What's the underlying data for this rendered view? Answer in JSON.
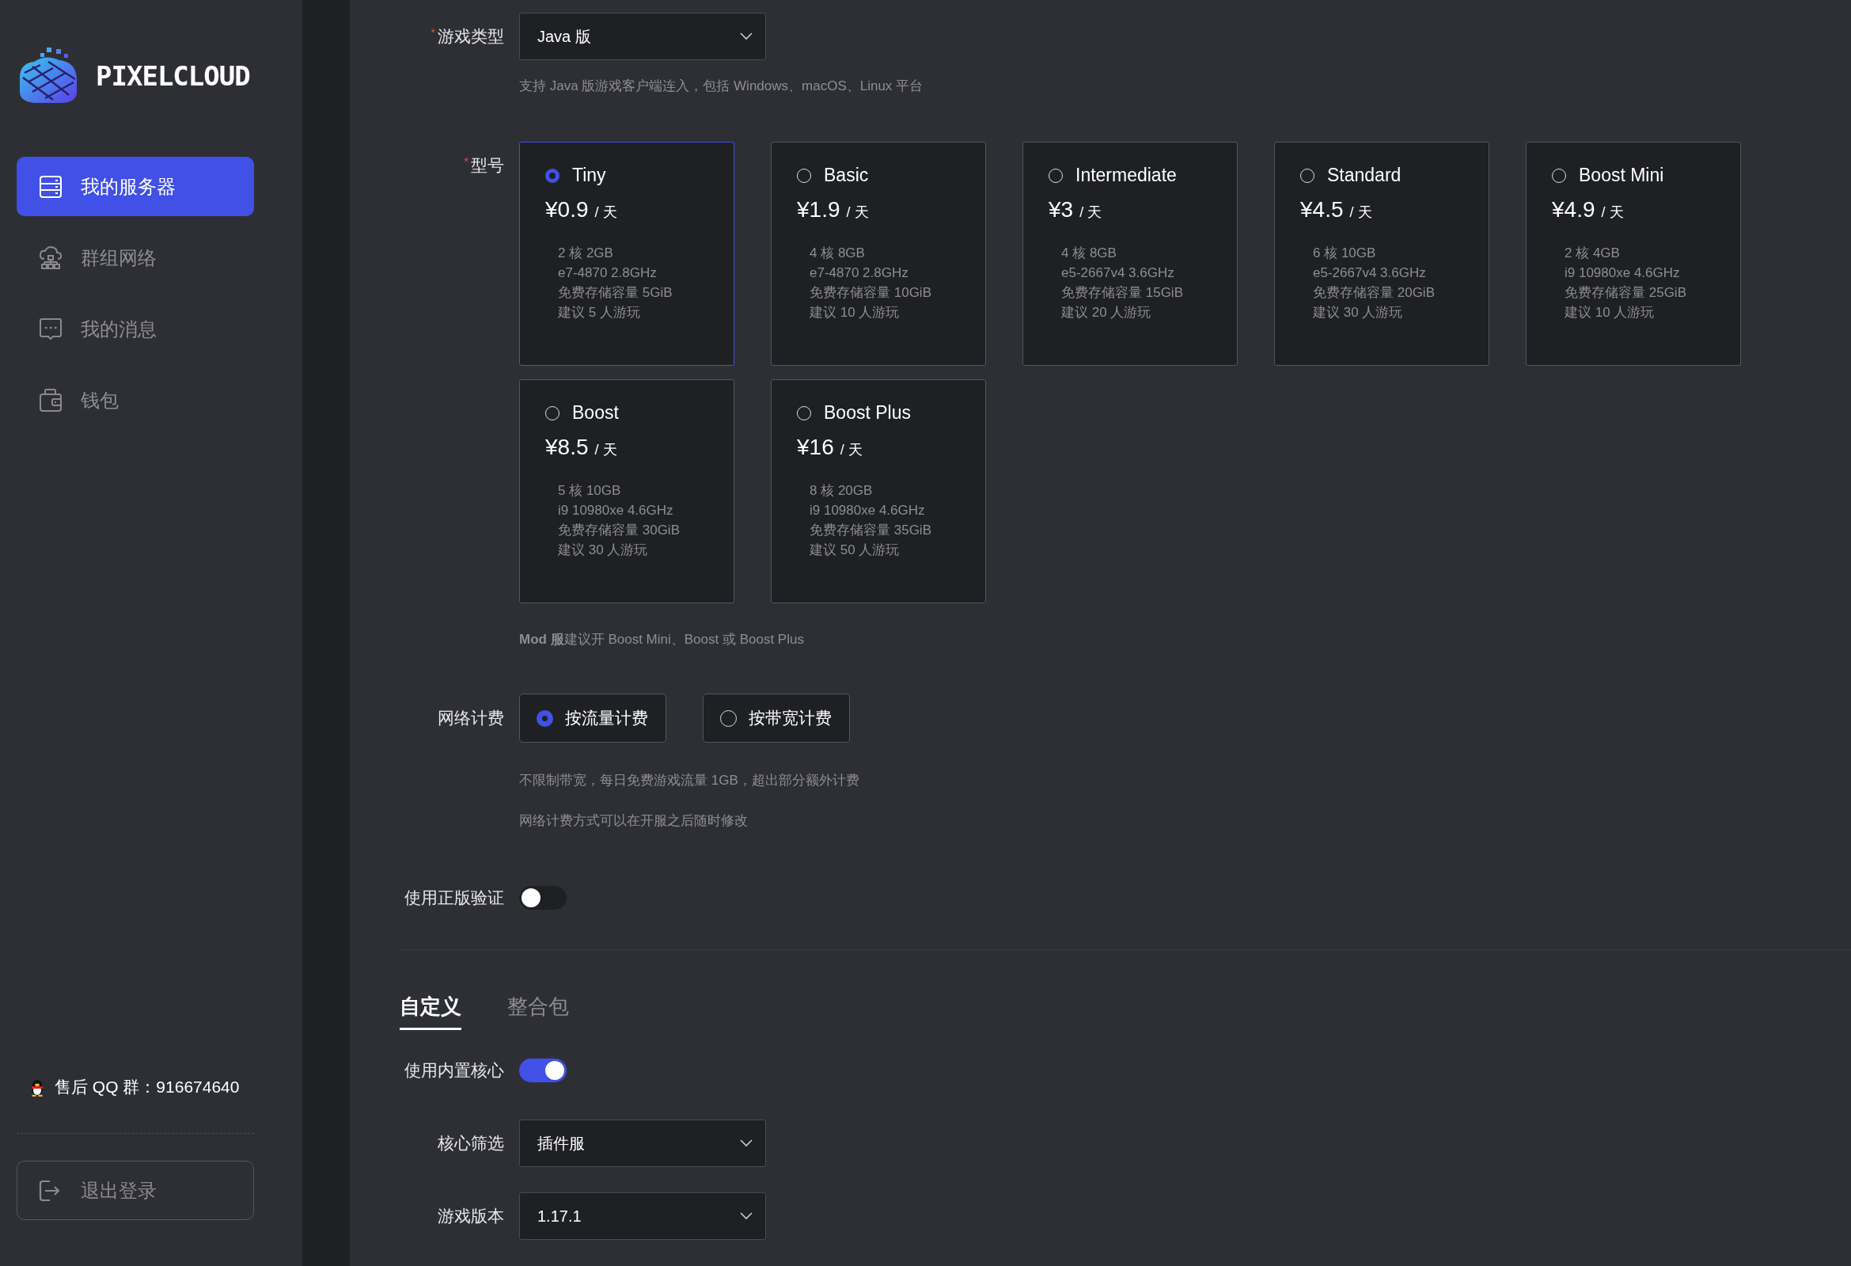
{
  "brand": {
    "name": "PIXELCLOUD"
  },
  "nav": [
    {
      "label": "我的服务器",
      "kind": "server",
      "selected": true
    },
    {
      "label": "群组网络",
      "kind": "cloud",
      "selected": false
    },
    {
      "label": "我的消息",
      "kind": "message",
      "selected": false
    },
    {
      "label": "钱包",
      "kind": "wallet",
      "selected": false
    }
  ],
  "support": {
    "text": "售后 QQ 群：916674640"
  },
  "logout": {
    "label": "退出登录"
  },
  "game_type": {
    "label": "游戏类型",
    "required_mark": "*",
    "value": "Java 版",
    "hint": "支持 Java 版游戏客户端连入，包括 Windows、macOS、Linux 平台"
  },
  "model": {
    "label": "型号",
    "required_mark": "*",
    "hint": "**Mod 服**建议开 Boost Mini、Boost 或 Boost Plus",
    "plans": [
      {
        "name": "Tiny",
        "price": "¥0.9",
        "unit": "/ 天",
        "selected": true,
        "specs": [
          "2 核 2GB",
          "e7-4870 2.8GHz",
          "免费存储容量 5GiB",
          "建议 5 人游玩"
        ]
      },
      {
        "name": "Basic",
        "price": "¥1.9",
        "unit": "/ 天",
        "selected": false,
        "specs": [
          "4 核 8GB",
          "e7-4870 2.8GHz",
          "免费存储容量 10GiB",
          "建议 10 人游玩"
        ]
      },
      {
        "name": "Intermediate",
        "price": "¥3",
        "unit": "/ 天",
        "selected": false,
        "specs": [
          "4 核 8GB",
          "e5-2667v4 3.6GHz",
          "免费存储容量 15GiB",
          "建议 20 人游玩"
        ]
      },
      {
        "name": "Standard",
        "price": "¥4.5",
        "unit": "/ 天",
        "selected": false,
        "specs": [
          "6 核 10GB",
          "e5-2667v4 3.6GHz",
          "免费存储容量 20GiB",
          "建议 30 人游玩"
        ]
      },
      {
        "name": "Boost Mini",
        "price": "¥4.9",
        "unit": "/ 天",
        "selected": false,
        "specs": [
          "2 核 4GB",
          "i9 10980xe 4.6GHz",
          "免费存储容量 25GiB",
          "建议 10 人游玩"
        ]
      },
      {
        "name": "Boost",
        "price": "¥8.5",
        "unit": "/ 天",
        "selected": false,
        "specs": [
          "5 核 10GB",
          "i9 10980xe 4.6GHz",
          "免费存储容量 30GiB",
          "建议 30 人游玩"
        ]
      },
      {
        "name": "Boost Plus",
        "price": "¥16",
        "unit": "/ 天",
        "selected": false,
        "specs": [
          "8 核 20GB",
          "i9 10980xe 4.6GHz",
          "免费存储容量 35GiB",
          "建议 50 人游玩"
        ]
      }
    ]
  },
  "network": {
    "label": "网络计费",
    "options": [
      {
        "label": "按流量计费",
        "selected": true
      },
      {
        "label": "按带宽计费",
        "selected": false
      }
    ],
    "hints": [
      "不限制带宽，每日免费游戏流量 1GB，超出部分额外计费",
      "网络计费方式可以在开服之后随时修改"
    ]
  },
  "auth": {
    "label": "使用正版验证",
    "on": false
  },
  "tabs": [
    {
      "label": "自定义",
      "selected": true
    },
    {
      "label": "整合包",
      "selected": false
    }
  ],
  "builtin_core": {
    "label": "使用内置核心",
    "on": true
  },
  "selects": [
    {
      "label": "核心筛选",
      "value": "插件服"
    },
    {
      "label": "游戏版本",
      "value": "1.17.1"
    }
  ]
}
